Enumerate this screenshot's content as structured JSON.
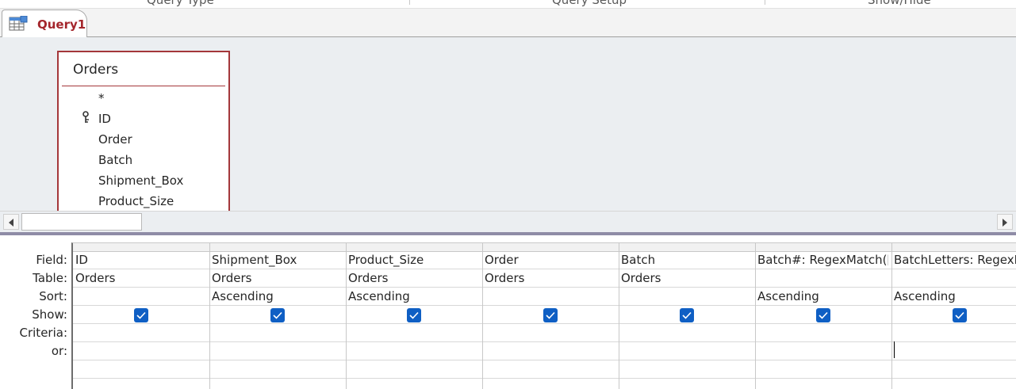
{
  "ribbon": {
    "groups": [
      {
        "label": "Query Type"
      },
      {
        "label": "Query Setup"
      },
      {
        "label": "Show/Hide"
      }
    ]
  },
  "document_tab": {
    "label": "Query1",
    "icon": "query-datasheet-icon",
    "accent": "#a4262c"
  },
  "table_box": {
    "title": "Orders",
    "fields": [
      "*",
      "ID",
      "Order",
      "Batch",
      "Shipment_Box",
      "Product_Size"
    ],
    "primary_key_field": "ID",
    "accent": "#a4373a"
  },
  "grid": {
    "row_labels": [
      "Field:",
      "Table:",
      "Sort:",
      "Show:",
      "Criteria:",
      "or:"
    ],
    "columns": [
      {
        "field": "ID",
        "table": "Orders",
        "sort": "",
        "show": true
      },
      {
        "field": "Shipment_Box",
        "table": "Orders",
        "sort": "Ascending",
        "show": true
      },
      {
        "field": "Product_Size",
        "table": "Orders",
        "sort": "Ascending",
        "show": true
      },
      {
        "field": "Order",
        "table": "Orders",
        "sort": "",
        "show": true
      },
      {
        "field": "Batch",
        "table": "Orders",
        "sort": "",
        "show": true
      },
      {
        "field": "Batch#: RegexMatch([Batch",
        "table": "",
        "sort": "Ascending",
        "show": true
      },
      {
        "field": "BatchLetters: RegexMatch",
        "table": "",
        "sort": "Ascending",
        "show": true
      }
    ],
    "checkbox_color": "#0f5fc4"
  }
}
